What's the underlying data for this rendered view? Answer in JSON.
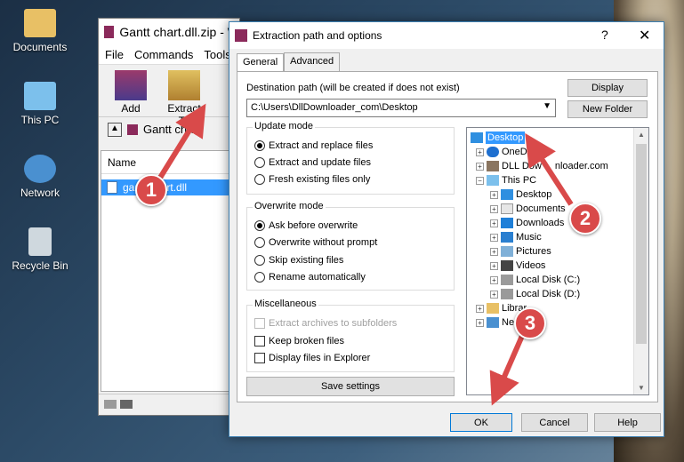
{
  "desktop": {
    "icons": [
      {
        "label": "Documents",
        "icon": "user-folder-icon"
      },
      {
        "label": "This PC",
        "icon": "computer-icon"
      },
      {
        "label": "Network",
        "icon": "network-icon"
      },
      {
        "label": "Recycle Bin",
        "icon": "recycle-bin-icon"
      }
    ]
  },
  "winrar": {
    "title": "Gantt chart.dll.zip - W",
    "menu": [
      "File",
      "Commands",
      "Tools"
    ],
    "tools": [
      {
        "label": "Add"
      },
      {
        "label": "Extract To"
      }
    ],
    "address": "Gantt chart",
    "list_header": "Name",
    "file": "gantt chart.dll"
  },
  "dialog": {
    "title": "Extraction path and options",
    "help": "?",
    "close": "✕",
    "tabs": [
      "General",
      "Advanced"
    ],
    "dest_label": "Destination path (will be created if does not exist)",
    "dest_value": "C:\\Users\\DllDownloader_com\\Desktop",
    "display_btn": "Display",
    "new_folder_btn": "New Folder",
    "update_mode": {
      "title": "Update mode",
      "options": [
        "Extract and replace files",
        "Extract and update files",
        "Fresh existing files only"
      ]
    },
    "overwrite_mode": {
      "title": "Overwrite mode",
      "options": [
        "Ask before overwrite",
        "Overwrite without prompt",
        "Skip existing files",
        "Rename automatically"
      ]
    },
    "misc": {
      "title": "Miscellaneous",
      "options": [
        "Extract archives to subfolders",
        "Keep broken files",
        "Display files in Explorer"
      ]
    },
    "save_settings": "Save settings",
    "tree": [
      {
        "label": "Desktop"
      },
      {
        "label": "OneD"
      },
      {
        "label": "DLL Dow"
      },
      {
        "label": "nloader.com"
      },
      {
        "label": "This PC"
      },
      {
        "label": "Desktop"
      },
      {
        "label": "Documents"
      },
      {
        "label": "Downloads"
      },
      {
        "label": "Music"
      },
      {
        "label": "Pictures"
      },
      {
        "label": "Videos"
      },
      {
        "label": "Local Disk (C:)"
      },
      {
        "label": "Local Disk (D:)"
      },
      {
        "label": "Librar"
      },
      {
        "label": "Ne"
      }
    ],
    "ok": "OK",
    "cancel": "Cancel",
    "help_btn": "Help"
  },
  "annotations": [
    "1",
    "2",
    "3"
  ],
  "colors": {
    "accent": "#3399ff",
    "annotation": "#d94a4a"
  }
}
